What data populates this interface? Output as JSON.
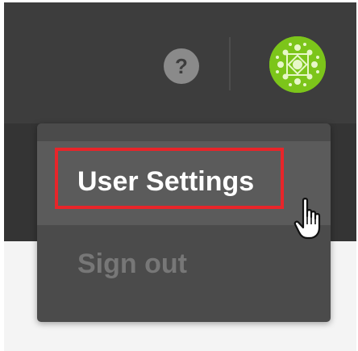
{
  "header": {
    "help_icon": "question-mark-icon",
    "help_glyph": "?",
    "avatar_icon": "user-avatar",
    "avatar_color": "#7cc51a"
  },
  "user_menu": {
    "items": [
      {
        "label": "User Settings",
        "highlighted": true
      },
      {
        "label": "Sign out",
        "highlighted": false
      }
    ],
    "highlight_color": "#e8252a"
  },
  "cursor": {
    "icon": "hand-pointer-cursor"
  }
}
